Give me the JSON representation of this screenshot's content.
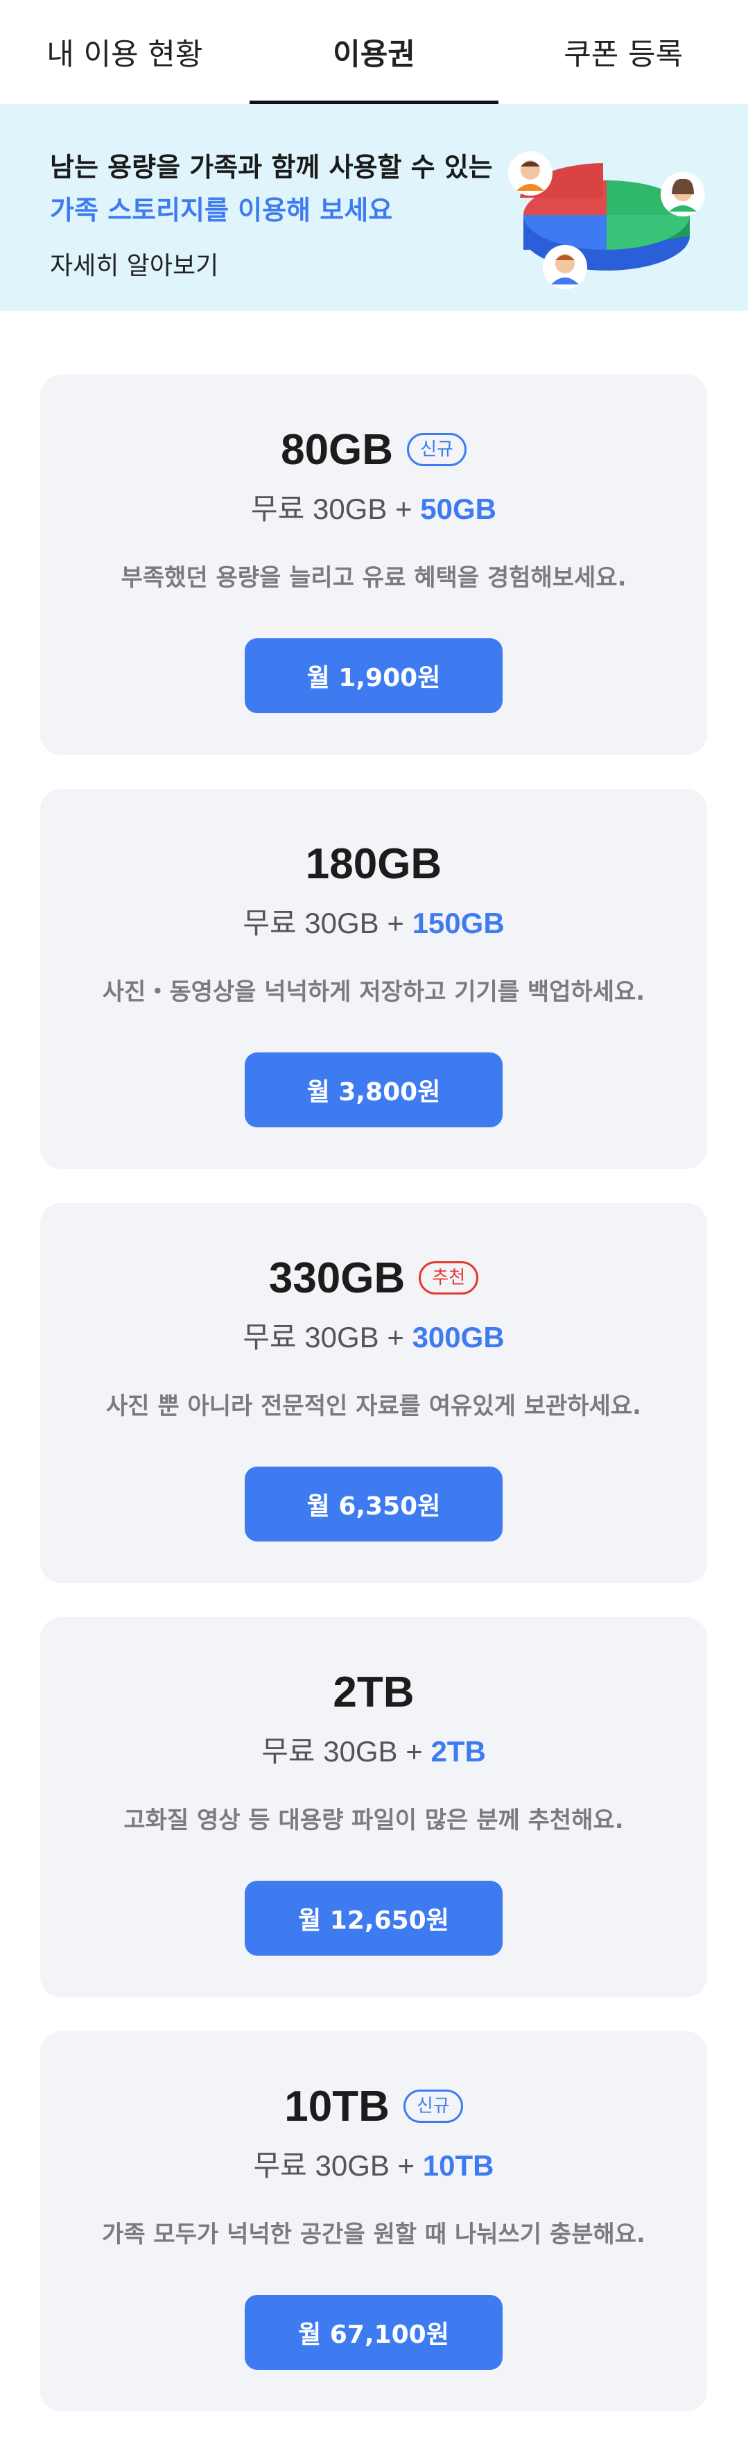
{
  "tabs": [
    {
      "label": "내 이용 현황",
      "active": false
    },
    {
      "label": "이용권",
      "active": true
    },
    {
      "label": "쿠폰 등록",
      "active": false
    }
  ],
  "banner": {
    "line1": "남는 용량을 가족과 함께 사용할 수 있는",
    "line2": "가족 스토리지를 이용해 보세요",
    "link": "자세히 알아보기"
  },
  "plans": [
    {
      "title": "80GB",
      "badge": "신규",
      "free": "무료 30GB",
      "plus": " + ",
      "extra": "50GB",
      "desc": "부족했던 용량을 늘리고 유료 혜택을 경험해보세요.",
      "price": "월 1,900원"
    },
    {
      "title": "180GB",
      "badge": "",
      "free": "무료 30GB",
      "plus": " + ",
      "extra": "150GB",
      "desc": "사진・동영상을 넉넉하게 저장하고 기기를 백업하세요.",
      "price": "월 3,800원"
    },
    {
      "title": "330GB",
      "badge": "추천",
      "free": "무료 30GB",
      "plus": " + ",
      "extra": "300GB",
      "desc": "사진 뿐 아니라 전문적인 자료를 여유있게 보관하세요.",
      "price": "월 6,350원"
    },
    {
      "title": "2TB",
      "badge": "",
      "free": "무료 30GB",
      "plus": " + ",
      "extra": "2TB",
      "desc": "고화질 영상 등 대용량 파일이 많은 분께 추천해요.",
      "price": "월 12,650원"
    },
    {
      "title": "10TB",
      "badge": "신규",
      "free": "무료 30GB",
      "plus": " + ",
      "extra": "10TB",
      "desc": "가족 모두가 넉넉한 공간을 원할 때 나눠쓰기 충분해요.",
      "price": "월 67,100원"
    }
  ],
  "colors": {
    "accent": "#3f7bf0",
    "recommend": "#e23a2f",
    "banner_bg": "#dff4fb",
    "card_bg": "#f3f4f8"
  }
}
